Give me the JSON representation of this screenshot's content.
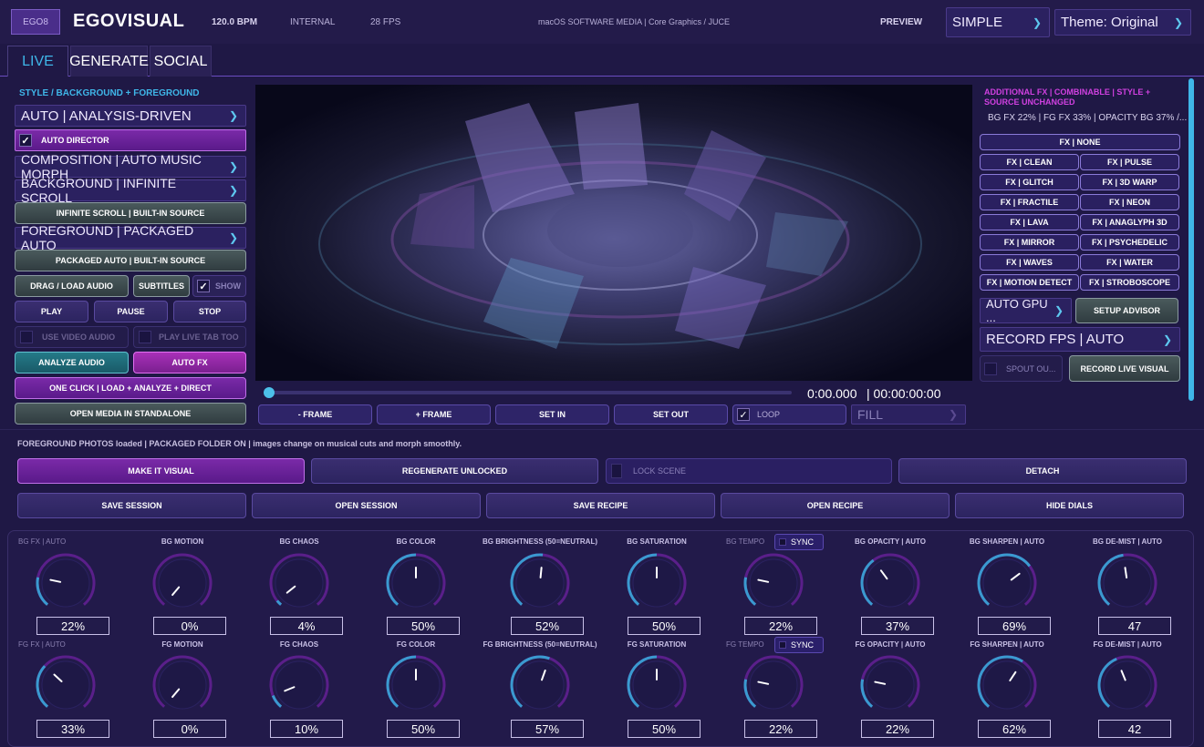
{
  "header": {
    "logo_badge": "EGO8",
    "app_name": "EGOVISUAL",
    "bpm": "120.0 BPM",
    "clock_source": "INTERNAL",
    "fps": "28 FPS",
    "platform": "macOS SOFTWARE MEDIA | Core Graphics / JUCE",
    "preview_label": "PREVIEW",
    "mode_select": "SIMPLE",
    "theme_select": "Theme: Original"
  },
  "tabs": [
    {
      "label": "LIVE"
    },
    {
      "label": "GENERATE"
    },
    {
      "label": "SOCIAL"
    }
  ],
  "left_panel": {
    "section_title": "STYLE / BACKGROUND + FOREGROUND",
    "style_select": "AUTO | ANALYSIS-DRIVEN",
    "auto_director": "AUTO DIRECTOR",
    "composition_select": "COMPOSITION | AUTO MUSIC MORPH",
    "background_select": "BACKGROUND | INFINITE SCROLL",
    "bg_source_button": "INFINITE SCROLL | BUILT-IN SOURCE",
    "foreground_select": "FOREGROUND | PACKAGED AUTO",
    "fg_source_button": "PACKAGED AUTO | BUILT-IN SOURCE",
    "drag_load_audio": "DRAG / LOAD AUDIO",
    "subtitles": "SUBTITLES",
    "show": "SHOW",
    "play": "PLAY",
    "pause": "PAUSE",
    "stop": "STOP",
    "use_video_audio": "USE VIDEO AUDIO",
    "play_live_tab_too": "PLAY LIVE TAB TOO",
    "analyze_audio": "ANALYZE AUDIO",
    "auto_fx": "AUTO FX",
    "one_click": "ONE CLICK | LOAD + ANALYZE + DIRECT",
    "open_standalone": "OPEN MEDIA IN STANDALONE"
  },
  "transport": {
    "time_current": "0:00.000",
    "time_total": "| 00:00:00:00",
    "progress": 0.0,
    "minus_frame": "- FRAME",
    "plus_frame": "+ FRAME",
    "set_in": "SET IN",
    "set_out": "SET OUT",
    "loop": "LOOP",
    "fit_select": "FILL"
  },
  "right_panel": {
    "title": "ADDITIONAL FX | COMBINABLE | STYLE + SOURCE UNCHANGED",
    "summary": "BG FX 22% | FG FX 33% | OPACITY BG 37% /...",
    "fx_none": "FX | NONE",
    "fx_buttons": [
      "FX | CLEAN",
      "FX | PULSE",
      "FX | GLITCH",
      "FX | 3D WARP",
      "FX | FRACTILE",
      "FX | NEON",
      "FX | LAVA",
      "FX | ANAGLYPH 3D",
      "FX | MIRROR",
      "FX | PSYCHEDELIC",
      "FX | WAVES",
      "FX | WATER",
      "FX | MOTION DETECT",
      "FX | STROBOSCOPE"
    ],
    "gpu_select": "AUTO GPU ...",
    "setup_advisor": "SETUP ADVISOR",
    "record_fps_select": "RECORD FPS | AUTO",
    "spout": "SPOUT OU...",
    "record_live": "RECORD LIVE VISUAL"
  },
  "status_line": "FOREGROUND PHOTOS loaded | PACKAGED FOLDER ON | images change on musical cuts and morph smoothly.",
  "actions": {
    "make_visual": "MAKE IT VISUAL",
    "regenerate": "REGENERATE UNLOCKED",
    "lock_scene": "LOCK SCENE",
    "detach": "DETACH",
    "save_session": "SAVE SESSION",
    "open_session": "OPEN SESSION",
    "save_recipe": "SAVE RECIPE",
    "open_recipe": "OPEN RECIPE",
    "hide_dials": "HIDE DIALS"
  },
  "sync_label": "SYNC",
  "dials_bg": [
    {
      "label": "BG FX | AUTO",
      "value": "22%",
      "level": 0.22,
      "dim": true
    },
    {
      "label": "BG MOTION",
      "value": "0%",
      "level": 0.0
    },
    {
      "label": "BG CHAOS",
      "value": "4%",
      "level": 0.04
    },
    {
      "label": "BG COLOR",
      "value": "50%",
      "level": 0.5
    },
    {
      "label": "BG BRIGHTNESS (50=NEUTRAL)",
      "value": "52%",
      "level": 0.52
    },
    {
      "label": "BG SATURATION",
      "value": "50%",
      "level": 0.5
    },
    {
      "label": "BG TEMPO",
      "value": "22%",
      "level": 0.22,
      "dim": true,
      "sync": true
    },
    {
      "label": "BG OPACITY | AUTO",
      "value": "37%",
      "level": 0.37
    },
    {
      "label": "BG SHARPEN | AUTO",
      "value": "69%",
      "level": 0.69
    },
    {
      "label": "BG DE-MIST | AUTO",
      "value": "47",
      "level": 0.47
    }
  ],
  "dials_fg": [
    {
      "label": "FG FX | AUTO",
      "value": "33%",
      "level": 0.33,
      "dim": true
    },
    {
      "label": "FG MOTION",
      "value": "0%",
      "level": 0.0
    },
    {
      "label": "FG CHAOS",
      "value": "10%",
      "level": 0.1
    },
    {
      "label": "FG COLOR",
      "value": "50%",
      "level": 0.5
    },
    {
      "label": "FG BRIGHTNESS (50=NEUTRAL)",
      "value": "57%",
      "level": 0.57
    },
    {
      "label": "FG SATURATION",
      "value": "50%",
      "level": 0.5
    },
    {
      "label": "FG TEMPO",
      "value": "22%",
      "level": 0.22,
      "dim": true,
      "sync": true
    },
    {
      "label": "FG OPACITY | AUTO",
      "value": "22%",
      "level": 0.22
    },
    {
      "label": "FG SHARPEN | AUTO",
      "value": "62%",
      "level": 0.62
    },
    {
      "label": "FG DE-MIST | AUTO",
      "value": "42",
      "level": 0.42
    }
  ]
}
